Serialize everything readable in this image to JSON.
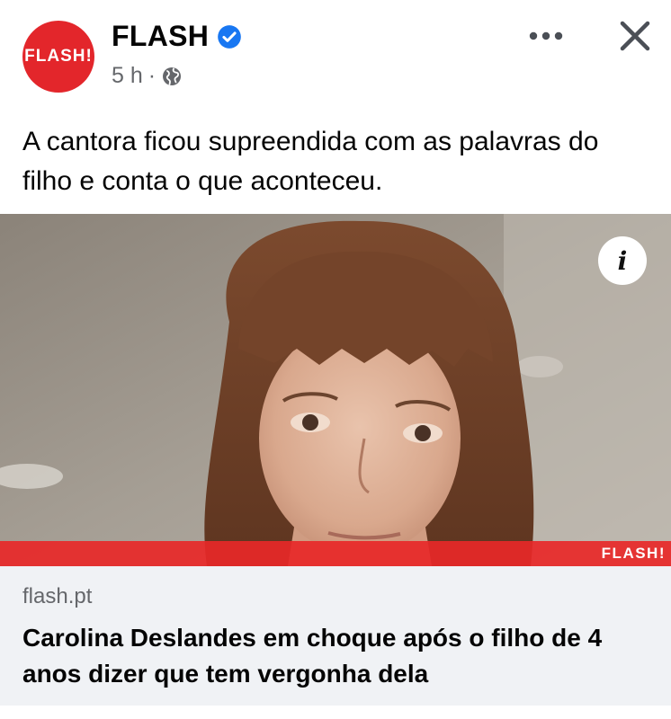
{
  "post": {
    "page_name": "FLASH",
    "avatar_text": "FLASH!",
    "time": "5 h",
    "separator": "·",
    "more_icon": "more-horizontal-icon",
    "close_icon": "close-icon",
    "verified_icon": "verified-badge-icon",
    "audience_icon": "globe-icon",
    "caption": "A cantora ficou supreendida com as palavras do filho e conta o que aconteceu."
  },
  "media": {
    "info_label": "i",
    "watermark": "FLASH!"
  },
  "link_preview": {
    "domain": "flash.pt",
    "headline": "Carolina Deslandes em choque após o filho de 4 anos dizer que tem vergonha dela"
  },
  "colors": {
    "brand_red": "#e3262b",
    "verified_blue": "#1877f2",
    "secondary_text": "#65676b",
    "link_bg": "#f0f2f5"
  }
}
